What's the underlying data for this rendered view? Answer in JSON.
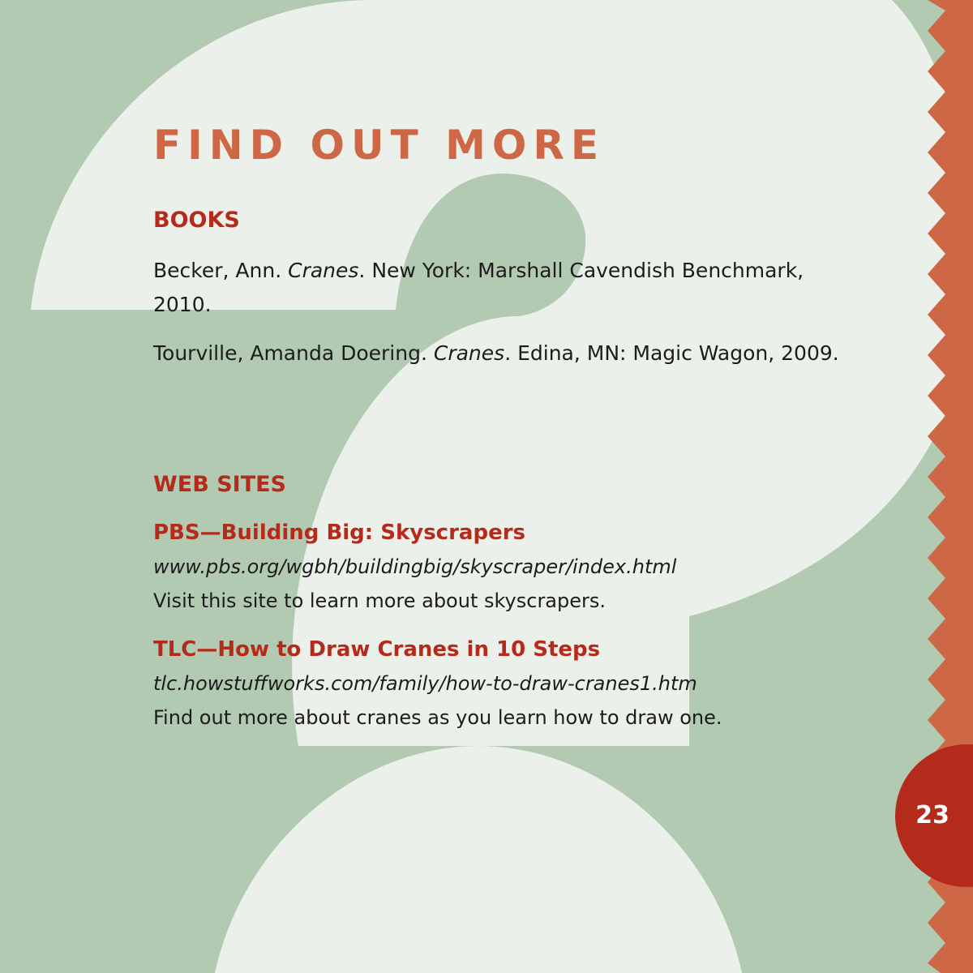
{
  "page": {
    "title": "FIND OUT MORE",
    "page_number": "23"
  },
  "books": {
    "heading": "BOOKS",
    "items": [
      {
        "before": "Becker, Ann. ",
        "title": "Cranes",
        "after": ". New York: Marshall Cavendish Benchmark, 2010."
      },
      {
        "before": "Tourville, Amanda Doering. ",
        "title": "Cranes",
        "after": ". Edina, MN: Magic Wagon, 2009."
      }
    ]
  },
  "web_sites": {
    "heading": "WEB SITES",
    "items": [
      {
        "title": "PBS—Building Big: Skyscrapers",
        "url": "www.pbs.org/wgbh/buildingbig/skyscraper/index.html",
        "description": "Visit this site to learn more about skyscrapers."
      },
      {
        "title": "TLC—How to Draw Cranes in 10 Steps",
        "url": "tlc.howstuffworks.com/family/how-to-draw-cranes1.htm",
        "description": "Find out more about cranes as you learn how to draw one."
      }
    ]
  },
  "colors": {
    "background_green": "#b2cab1",
    "question_mark": "#ecf0ea",
    "title_orange": "#cd6745",
    "heading_red": "#b42b1b",
    "zigzag_orange": "#cd6745",
    "page_circle": "#b42b1b"
  }
}
